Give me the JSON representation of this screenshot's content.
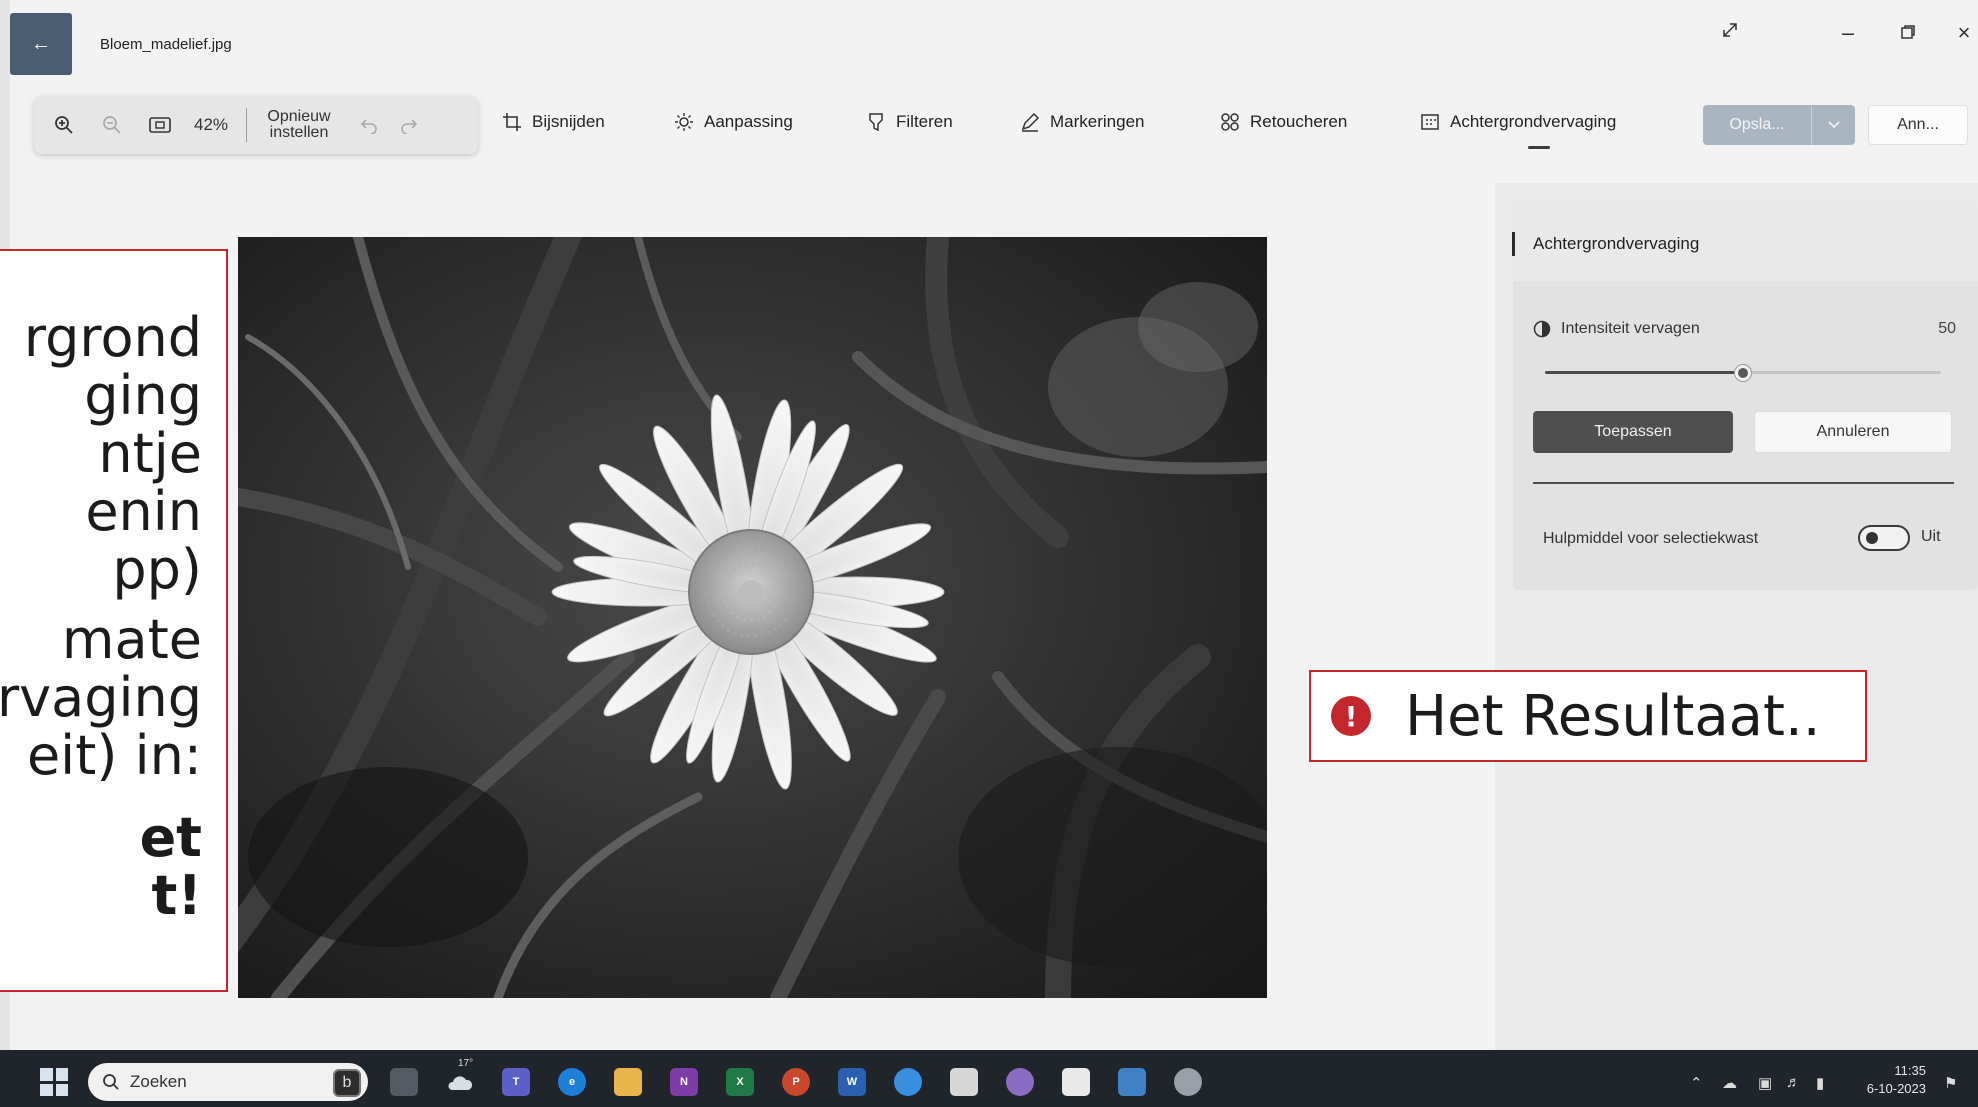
{
  "window": {
    "title": "Bloem_madelief.jpg",
    "back_icon": "back-arrow-icon",
    "controls": [
      "expand-icon",
      "minimize-icon",
      "maximize-icon",
      "close-icon"
    ]
  },
  "zoom": {
    "percent": "42%",
    "reset_label": "Opnieuw instellen"
  },
  "toolbar": {
    "items": [
      {
        "label": "Bijsnijden",
        "icon": "crop-icon"
      },
      {
        "label": "Aanpassing",
        "icon": "brightness-icon"
      },
      {
        "label": "Filteren",
        "icon": "filter-icon"
      },
      {
        "label": "Markeringen",
        "icon": "pen-icon"
      },
      {
        "label": "Retoucheren",
        "icon": "retouch-icon"
      },
      {
        "label": "Achtergrondvervaging",
        "icon": "background-blur-icon"
      }
    ],
    "active": "Achtergrondvervaging",
    "save_label": "Opsla...",
    "cancel_label": "Ann..."
  },
  "callout_left": {
    "lines": [
      "rgrond",
      "ging",
      "ntje",
      "enin",
      "pp)",
      "mate",
      "rvaging",
      "eit) in:",
      "et",
      "t!"
    ]
  },
  "panel": {
    "title": "Achtergrondvervaging",
    "intensity_label": "Intensiteit vervagen",
    "intensity_value": "50",
    "slider_fraction": 0.5,
    "apply_label": "Toepassen",
    "cancel_label": "Annuleren",
    "brush_label": "Hulpmiddel voor selectiekwast",
    "toggle_state": "Uit"
  },
  "result": {
    "text": "Het Resultaat.."
  },
  "taskbar": {
    "search_label": "Zoeken",
    "weather_temp": "17°",
    "time": "11:35",
    "date": "6-10-2023",
    "colors": {
      "background": "#20242b",
      "accent": "#c0282d"
    }
  }
}
